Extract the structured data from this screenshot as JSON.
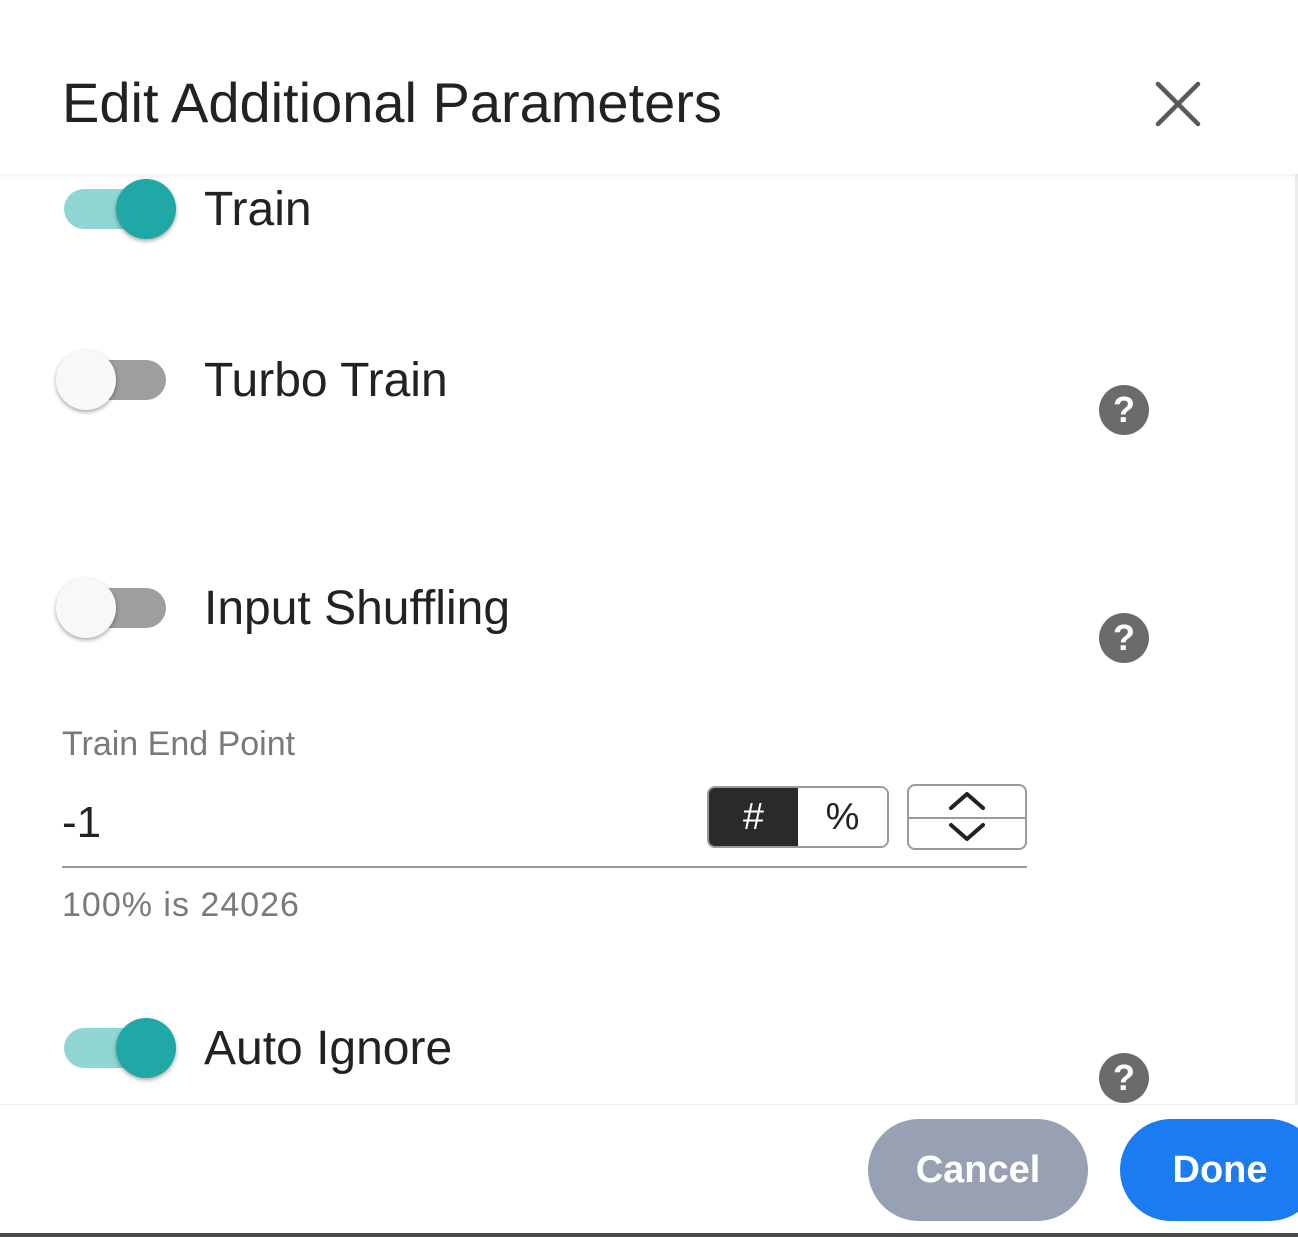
{
  "dialog": {
    "title": "Edit Additional Parameters",
    "close_icon": "close-icon"
  },
  "toggles": [
    {
      "label": "Train",
      "on": true,
      "help": false
    },
    {
      "label": "Turbo Train",
      "on": false,
      "help": true
    },
    {
      "label": "Input Shuffling",
      "on": false,
      "help": true
    },
    {
      "label": "Auto Ignore",
      "on": true,
      "help": true
    }
  ],
  "train_end_point": {
    "label": "Train End Point",
    "value": "-1",
    "unit_options": [
      "#",
      "%"
    ],
    "selected_unit": "#",
    "hint": "100% is 24026"
  },
  "help_icon_glyph": "?",
  "footer": {
    "cancel_label": "Cancel",
    "done_label": "Done"
  },
  "colors": {
    "toggle_on": "#1fa8a6",
    "toggle_on_track": "#8fd6d4",
    "toggle_off_track": "#9e9e9e",
    "primary": "#1a7cf0",
    "secondary": "#98a1b3",
    "help_icon": "#6b6b6b"
  }
}
